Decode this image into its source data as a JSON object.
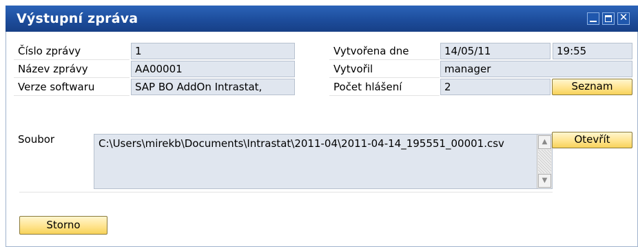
{
  "window": {
    "title": "Výstupní zpráva",
    "controls": {
      "minimize_icon": "minimize-icon",
      "maximize_icon": "maximize-icon",
      "close_icon": "close-icon",
      "close_glyph": "✕"
    }
  },
  "fields": {
    "cislo_zpravy": {
      "label": "Číslo zprávy",
      "value": "1"
    },
    "nazev_zpravy": {
      "label": "Název zprávy",
      "value": "AA00001"
    },
    "verze_softwaru": {
      "label": "Verze softwaru",
      "value": "SAP BO AddOn Intrastat,"
    },
    "vytvorena_dne": {
      "label": "Vytvořena dne",
      "date": "14/05/11",
      "time": "19:55"
    },
    "vytvoril": {
      "label": "Vytvořil",
      "value": "manager"
    },
    "pocet_hlaseni": {
      "label": "Počet hlášení",
      "value": "2"
    },
    "soubor": {
      "label": "Soubor",
      "value": "C:\\Users\\mirekb\\Documents\\Intrastat\\2011-04\\2011-04-14_195551_00001.csv"
    }
  },
  "buttons": {
    "seznam": "Seznam",
    "otevrit": "Otevřít",
    "storno": "Storno"
  },
  "scrollbar": {
    "up_glyph": "▲",
    "down_glyph": "▼"
  },
  "colors": {
    "title_bar": "#1d4d9c",
    "field_bg": "#e0e6ef",
    "button_bg": "#ffe48f"
  }
}
